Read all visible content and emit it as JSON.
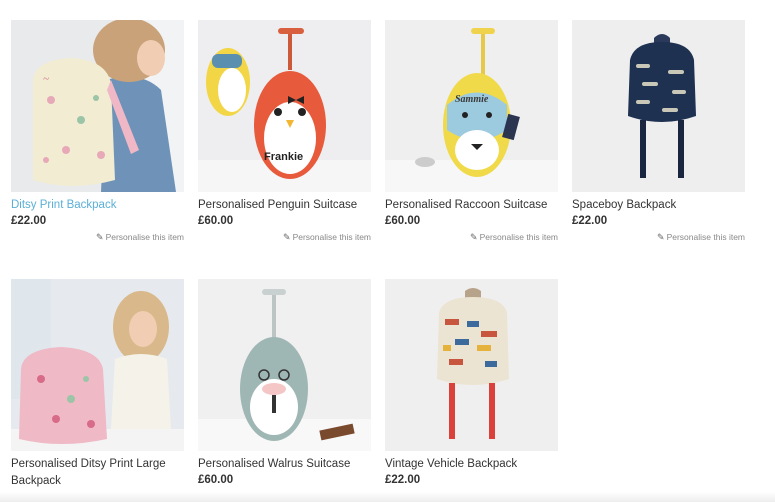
{
  "products": [
    {
      "name": "Ditsy Print Backpack",
      "price": "£22.00",
      "personalise": "Personalise this item"
    },
    {
      "name": "Personalised Penguin Suitcase",
      "price": "£60.00",
      "personalise": "Personalise this item",
      "print": "Frankie"
    },
    {
      "name": "Personalised Raccoon Suitcase",
      "price": "£60.00",
      "personalise": "Personalise this item",
      "print": "Sammie"
    },
    {
      "name": "Spaceboy Backpack",
      "price": "£22.00",
      "personalise": "Personalise this item"
    },
    {
      "name": "Personalised Ditsy Print Large Backpack",
      "price": "",
      "personalise": ""
    },
    {
      "name": "Personalised Walrus Suitcase",
      "price": "£60.00",
      "personalise": ""
    },
    {
      "name": "Vintage Vehicle Backpack",
      "price": "£22.00",
      "personalise": ""
    }
  ],
  "colors": {
    "link": "#5bb0d6",
    "text": "#333333",
    "muted": "#888888"
  },
  "icons": {
    "personalise": "pencil-icon"
  }
}
